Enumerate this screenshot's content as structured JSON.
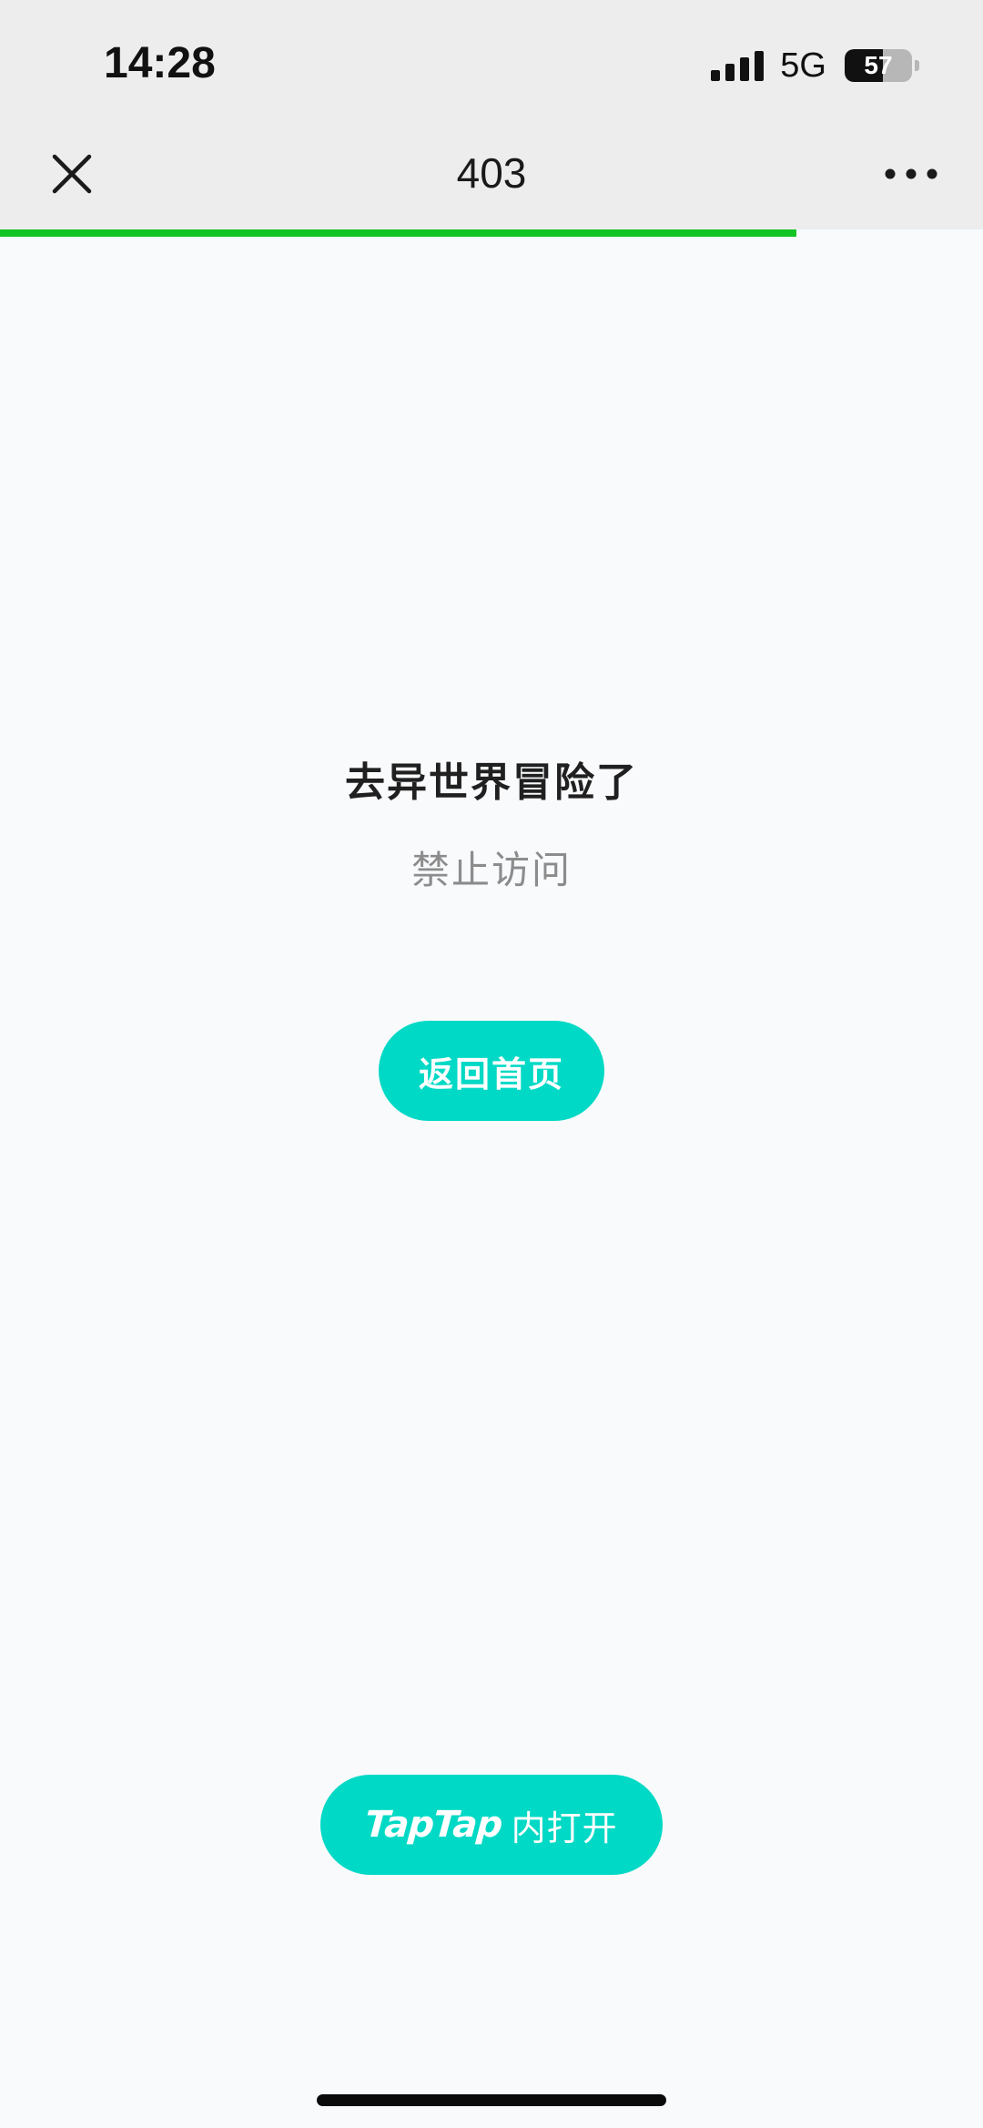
{
  "status_bar": {
    "time": "14:28",
    "network": "5G",
    "battery_level": "57",
    "battery_fraction": 0.57,
    "signal_bars": 4
  },
  "nav_bar": {
    "title": "403",
    "close_icon": "close-icon",
    "more_icon": "more-dots-icon",
    "page_load_progress": 0.81
  },
  "content": {
    "headline": "去异世界冒险了",
    "subline": "禁止访问",
    "home_button_label": "返回首页"
  },
  "footer": {
    "brand_logo": "TapTap",
    "open_in_app_suffix": "内打开"
  },
  "colors": {
    "accent": "#00d9c5",
    "progress": "#13c425",
    "nav_background": "#ededed",
    "page_background": "#f8fafc"
  }
}
